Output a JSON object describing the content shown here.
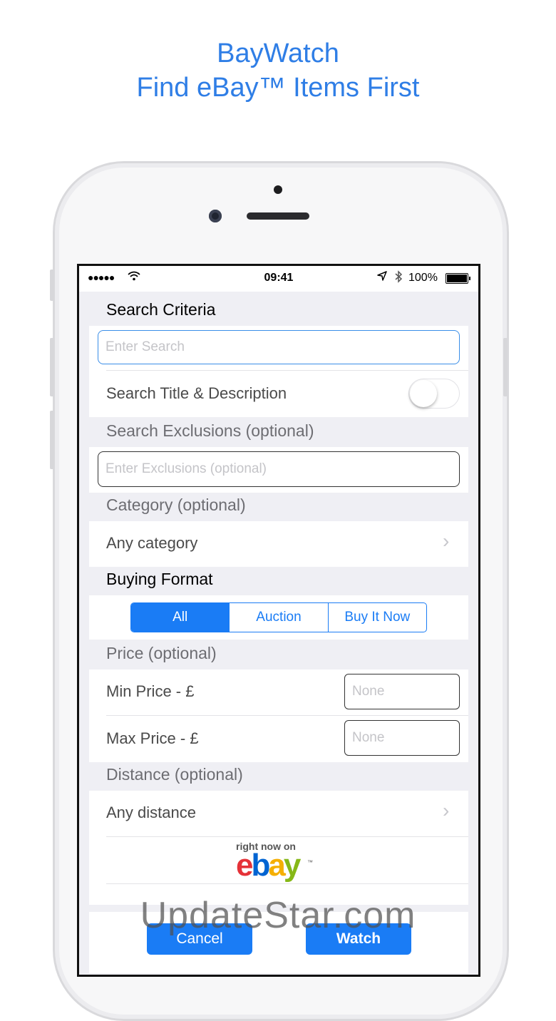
{
  "headline": {
    "line1": "BayWatch",
    "line2": "Find eBay™ Items First",
    "color": "#2f7ee6"
  },
  "status_bar": {
    "signal": "●●●●●",
    "time": "09:41",
    "battery_pct": "100%",
    "battery_level": 1.0
  },
  "form": {
    "search_criteria_title": "Search Criteria",
    "search_placeholder": "Enter Search",
    "search_title_desc_label": "Search Title & Description",
    "search_title_desc_on": false,
    "exclusions_title": "Search Exclusions (optional)",
    "exclusions_placeholder": "Enter Exclusions (optional)",
    "category_title": "Category (optional)",
    "category_value": "Any category",
    "buying_format_title": "Buying Format",
    "buying_format_options": [
      "All",
      "Auction",
      "Buy It Now"
    ],
    "buying_format_selected": "All",
    "price_title": "Price (optional)",
    "min_price_label": "Min Price - £",
    "min_price_placeholder": "None",
    "max_price_label": "Max Price - £",
    "max_price_placeholder": "None",
    "distance_title": "Distance (optional)",
    "distance_value": "Any distance"
  },
  "ebay_badge": {
    "tagline": "right now on",
    "letters": [
      "e",
      "b",
      "a",
      "y"
    ],
    "tm": "™",
    "colors": [
      "#e53238",
      "#0064d2",
      "#f5af02",
      "#86b817"
    ]
  },
  "footer": {
    "cancel_label": "Cancel",
    "watch_label": "Watch",
    "button_color": "#1a7cf5"
  },
  "watermark": "UpdateStar.com"
}
